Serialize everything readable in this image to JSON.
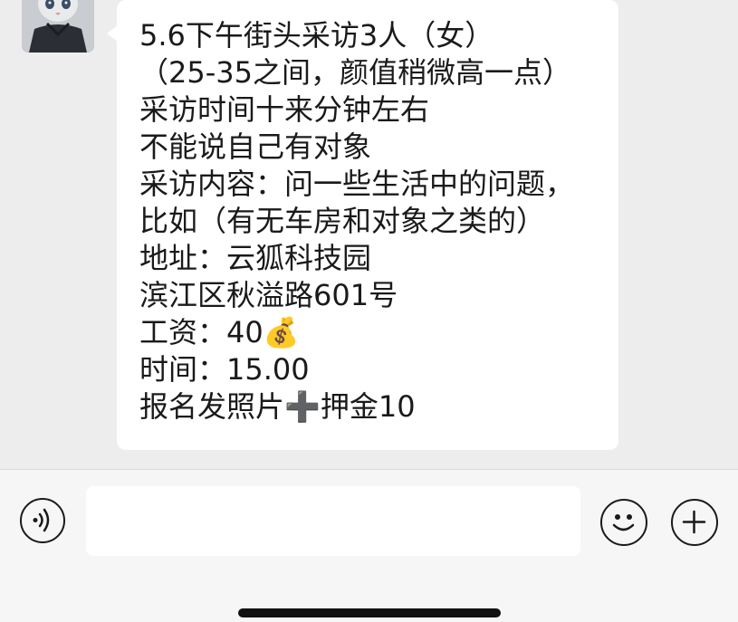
{
  "chat": {
    "message": {
      "lines": [
        "5.6下午街头采访3人（女）",
        "（25-35之间，颜值稍微高一点）",
        "采访时间十来分钟左右",
        "不能说自己有对象",
        "采访内容：问一些生活中的问题，",
        "比如（有无车房和对象之类的）",
        "地址：云狐科技园",
        "滨江区秋溢路601号",
        "工资：40💰",
        "时间：15.00",
        "报名发照片➕押金10"
      ]
    },
    "avatar_icon": "cat-avatar"
  },
  "input_bar": {
    "voice_icon": "voice-icon",
    "text_value": "",
    "emoji_icon": "emoji-icon",
    "plus_icon": "plus-icon"
  },
  "colors": {
    "chat_background": "#ededed",
    "bubble": "#ffffff",
    "text": "#1a1a1a",
    "input_bar": "#f6f6f6"
  }
}
